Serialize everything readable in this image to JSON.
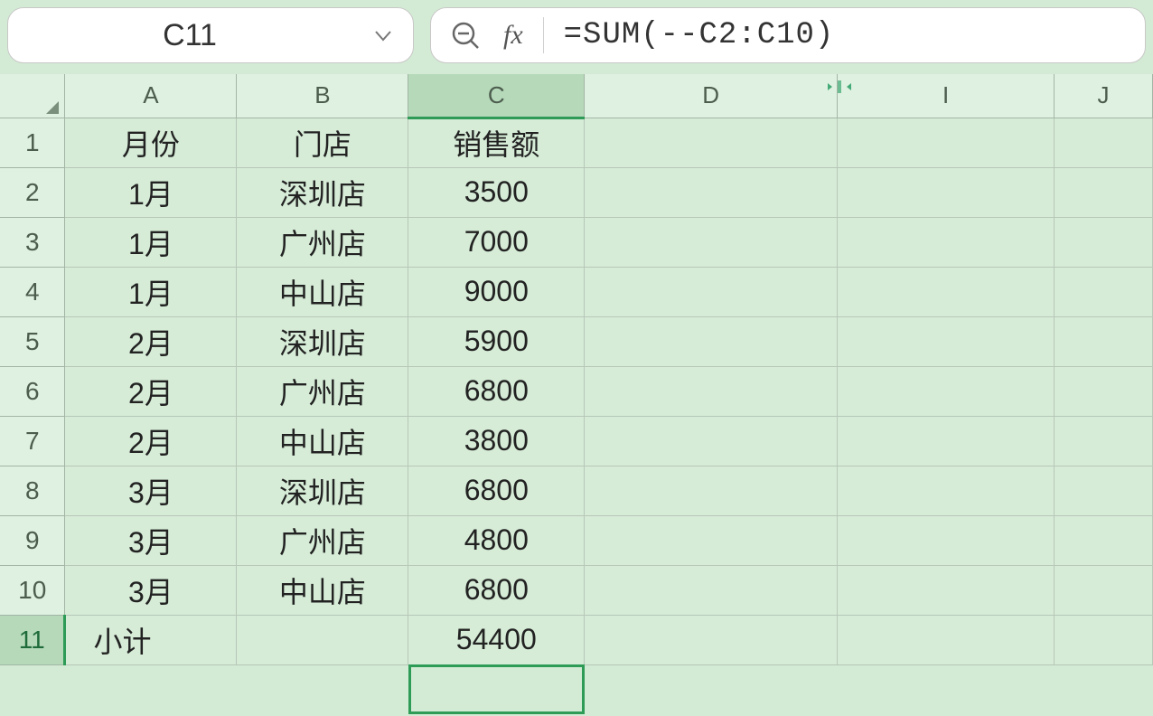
{
  "name_box": {
    "ref": "C11"
  },
  "formula_bar": {
    "fx": "fx",
    "formula": "=SUM(--C2:C10)"
  },
  "columns": [
    "A",
    "B",
    "C",
    "D",
    "I",
    "J"
  ],
  "selected_col": "C",
  "selected_row": "11",
  "row_numbers": [
    "1",
    "2",
    "3",
    "4",
    "5",
    "6",
    "7",
    "8",
    "9",
    "10",
    "11"
  ],
  "headers": {
    "a": "月份",
    "b": "门店",
    "c": "销售额"
  },
  "rows": [
    {
      "a": "1月",
      "b": "深圳店",
      "c": "3500",
      "group": "g1"
    },
    {
      "a": "1月",
      "b": "广州店",
      "c": "7000",
      "group": "g1"
    },
    {
      "a": "1月",
      "b": "中山店",
      "c": "9000",
      "group": "g1"
    },
    {
      "a": "2月",
      "b": "深圳店",
      "c": "5900",
      "group": "b1"
    },
    {
      "a": "2月",
      "b": "广州店",
      "c": "6800",
      "group": "b1"
    },
    {
      "a": "2月",
      "b": "中山店",
      "c": "3800",
      "group": "b1"
    },
    {
      "a": "3月",
      "b": "深圳店",
      "c": "6800",
      "group": "g1"
    },
    {
      "a": "3月",
      "b": "广州店",
      "c": "4800",
      "group": "g1"
    },
    {
      "a": "3月",
      "b": "中山店",
      "c": "6800",
      "group": "g1"
    }
  ],
  "subtotal": {
    "label": "小计",
    "value": "54400"
  }
}
